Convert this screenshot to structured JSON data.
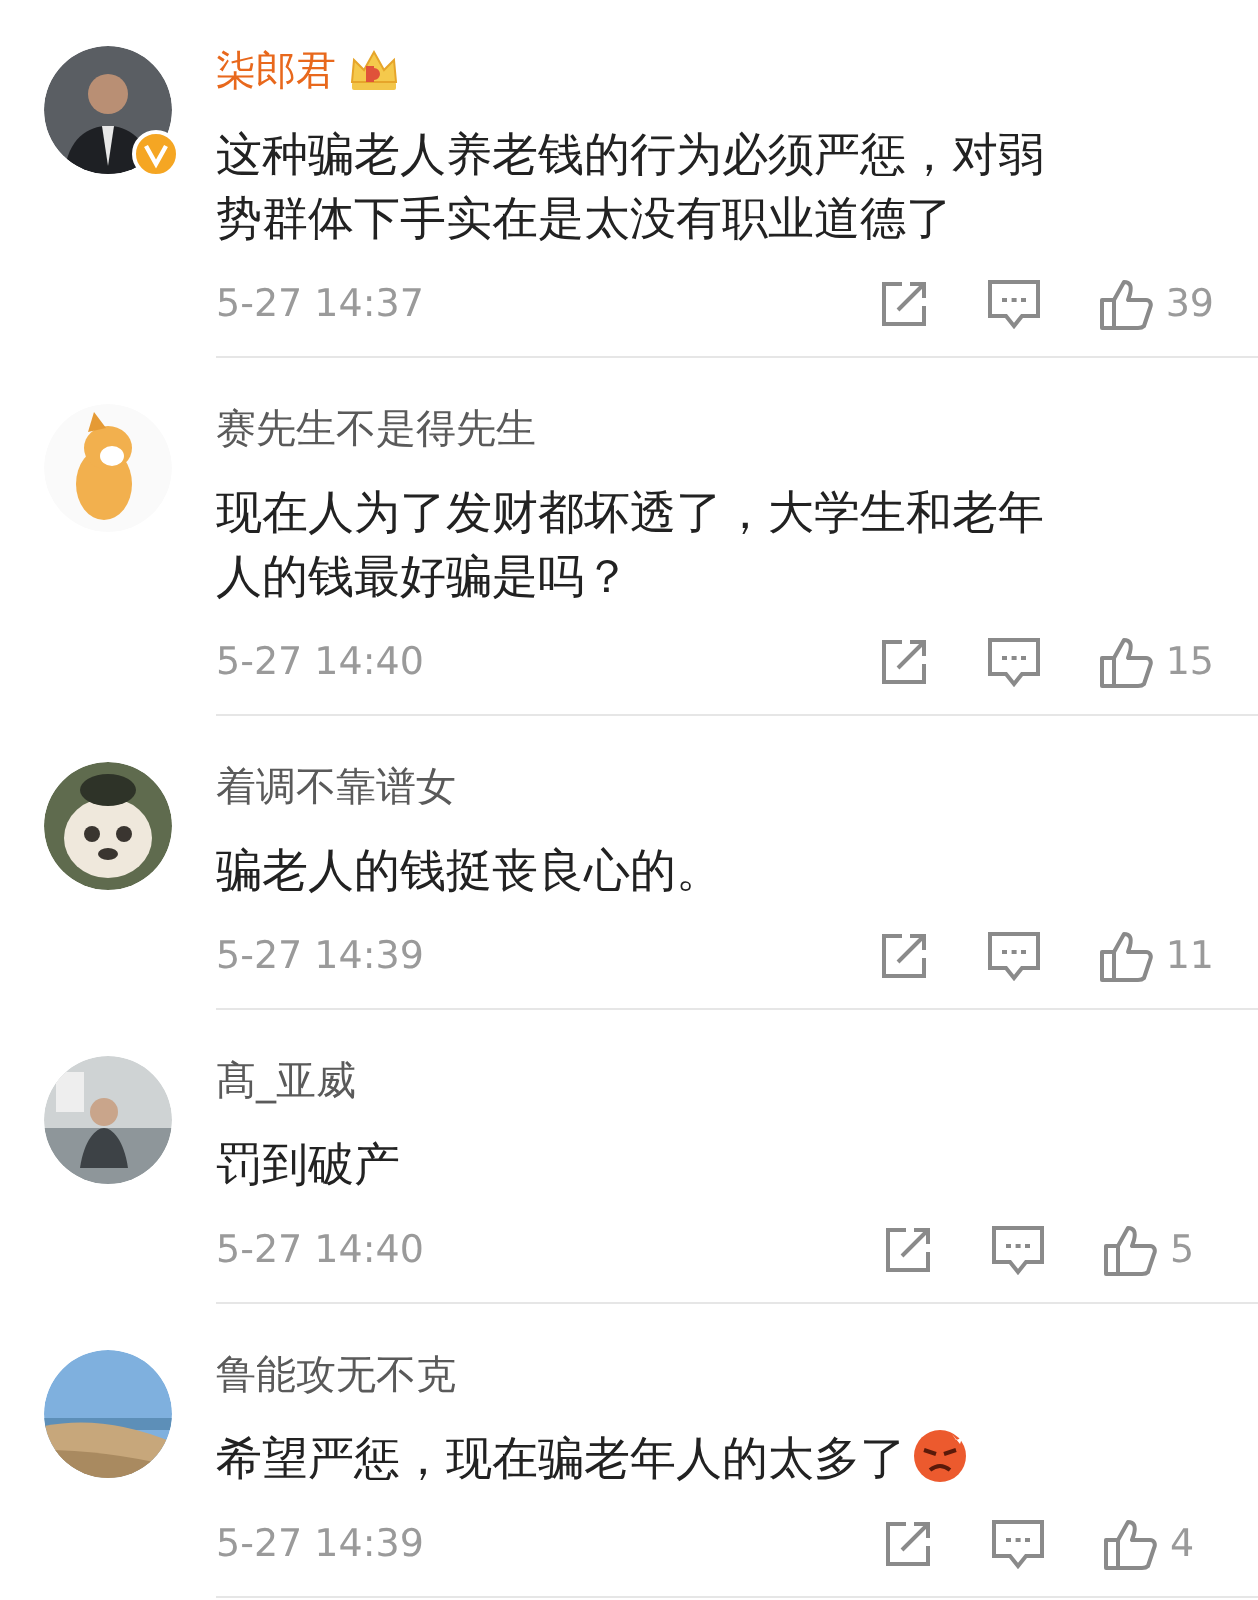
{
  "comments": [
    {
      "name": "柒郎君",
      "vip": true,
      "verified": true,
      "text": "这种骗老人养老钱的行为必须严惩，对弱势群体下手实在是太没有职业道德了",
      "emoji": false,
      "time": "5-27 14:37",
      "likes": "39"
    },
    {
      "name": "赛先生不是得先生",
      "vip": false,
      "verified": false,
      "text": "现在人为了发财都坏透了，大学生和老年人的钱最好骗是吗？",
      "emoji": false,
      "time": "5-27 14:40",
      "likes": "15"
    },
    {
      "name": "着调不靠谱女",
      "vip": false,
      "verified": false,
      "text": "骗老人的钱挺丧良心的。",
      "emoji": false,
      "time": "5-27 14:39",
      "likes": "11"
    },
    {
      "name": "髙_亚威",
      "vip": false,
      "verified": false,
      "text": "罚到破产",
      "emoji": false,
      "time": "5-27 14:40",
      "likes": "5"
    },
    {
      "name": "鲁能攻无不克",
      "vip": false,
      "verified": false,
      "text": "希望严惩，现在骗老年人的太多了",
      "emoji": true,
      "time": "5-27 14:39",
      "likes": "4"
    }
  ]
}
